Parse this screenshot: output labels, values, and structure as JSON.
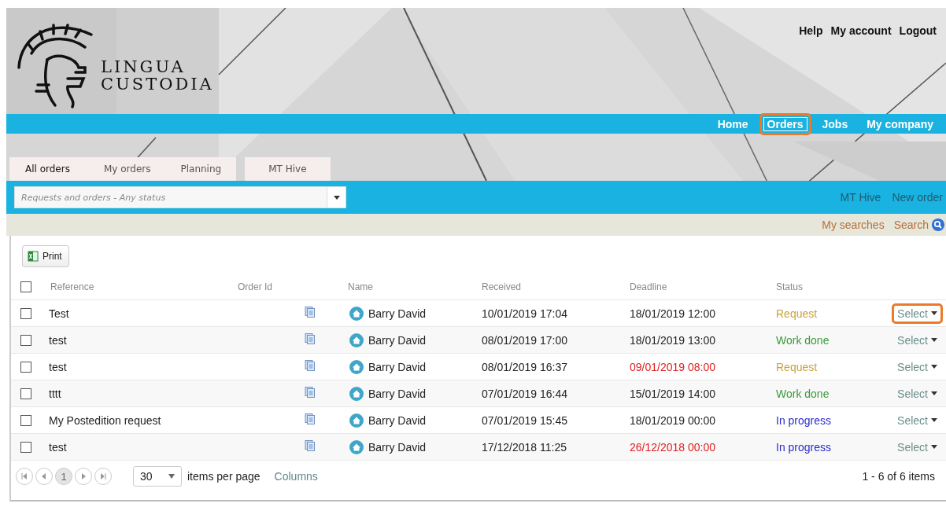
{
  "logo": {
    "lines": [
      "LINGUA",
      "CUSTODIA"
    ]
  },
  "top_links": [
    "Help",
    "My account",
    "Logout"
  ],
  "nav": [
    {
      "label": "Home",
      "selected": false,
      "highlighted": false
    },
    {
      "label": "Orders",
      "selected": true,
      "highlighted": true
    },
    {
      "label": "Jobs",
      "selected": false,
      "highlighted": false
    },
    {
      "label": "My company",
      "selected": false,
      "highlighted": false
    }
  ],
  "tabs": [
    {
      "label": "All orders",
      "selected": true,
      "separated": false
    },
    {
      "label": "My orders",
      "selected": false,
      "separated": false
    },
    {
      "label": "Planning",
      "selected": false,
      "separated": false
    },
    {
      "label": "MT Hive",
      "selected": false,
      "separated": true
    }
  ],
  "filter": {
    "placeholder": "Requests and orders - Any status"
  },
  "actions": [
    {
      "label": "MT Hive",
      "disabled": true
    },
    {
      "label": "New order",
      "disabled": true
    }
  ],
  "search_links": [
    "My searches",
    "Search"
  ],
  "print_button": "Print",
  "table": {
    "select_all": {
      "checked": false
    },
    "columns": [
      "Reference",
      "Order Id",
      "Name",
      "Received",
      "Deadline",
      "Status"
    ],
    "rows": [
      {
        "checked": false,
        "reference": "Test",
        "name": "Barry David",
        "received": "10/01/2019 17:04",
        "deadline": "18/01/2019 12:00",
        "overdue": false,
        "status": "Request",
        "color": "#c9a23c",
        "action": "Select",
        "highlighted": true
      },
      {
        "checked": false,
        "reference": "test",
        "name": "Barry David",
        "received": "08/01/2019 17:00",
        "deadline": "18/01/2019 13:00",
        "overdue": false,
        "status": "Work done",
        "color": "#3a9a3a",
        "action": "Select",
        "highlighted": false
      },
      {
        "checked": false,
        "reference": "test",
        "name": "Barry David",
        "received": "08/01/2019 16:37",
        "deadline": "09/01/2019 08:00",
        "overdue": true,
        "status": "Request",
        "color": "#c9a23c",
        "action": "Select",
        "highlighted": false
      },
      {
        "checked": false,
        "reference": "tttt",
        "name": "Barry David",
        "received": "07/01/2019 16:44",
        "deadline": "15/01/2019 14:00",
        "overdue": false,
        "status": "Work done",
        "color": "#3a9a3a",
        "action": "Select",
        "highlighted": false
      },
      {
        "checked": false,
        "reference": "My Postedition request",
        "name": "Barry David",
        "received": "07/01/2019 15:45",
        "deadline": "18/01/2019 00:00",
        "overdue": false,
        "status": "In progress",
        "color": "#2a2ad0",
        "action": "Select",
        "highlighted": false
      },
      {
        "checked": false,
        "reference": "test",
        "name": "Barry David",
        "received": "17/12/2018 11:25",
        "deadline": "26/12/2018 00:00",
        "overdue": true,
        "status": "In progress",
        "color": "#2a2ad0",
        "action": "Select",
        "highlighted": false
      }
    ]
  },
  "pager": {
    "pages": [
      {
        "label": "1",
        "selected": true
      }
    ],
    "page_size": "30",
    "page_size_label": "items per page",
    "columns_link": "Columns",
    "summary": "1 - 6 of 6 items"
  }
}
